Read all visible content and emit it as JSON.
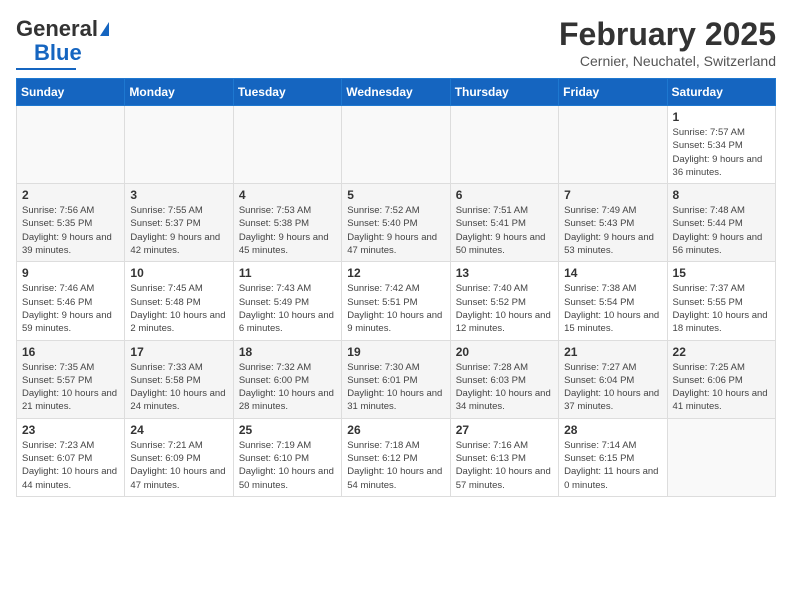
{
  "header": {
    "logo_general": "General",
    "logo_blue": "Blue",
    "main_title": "February 2025",
    "subtitle": "Cernier, Neuchatel, Switzerland"
  },
  "weekdays": [
    "Sunday",
    "Monday",
    "Tuesday",
    "Wednesday",
    "Thursday",
    "Friday",
    "Saturday"
  ],
  "weeks": [
    [
      {
        "day": "",
        "info": ""
      },
      {
        "day": "",
        "info": ""
      },
      {
        "day": "",
        "info": ""
      },
      {
        "day": "",
        "info": ""
      },
      {
        "day": "",
        "info": ""
      },
      {
        "day": "",
        "info": ""
      },
      {
        "day": "1",
        "info": "Sunrise: 7:57 AM\nSunset: 5:34 PM\nDaylight: 9 hours and 36 minutes."
      }
    ],
    [
      {
        "day": "2",
        "info": "Sunrise: 7:56 AM\nSunset: 5:35 PM\nDaylight: 9 hours and 39 minutes."
      },
      {
        "day": "3",
        "info": "Sunrise: 7:55 AM\nSunset: 5:37 PM\nDaylight: 9 hours and 42 minutes."
      },
      {
        "day": "4",
        "info": "Sunrise: 7:53 AM\nSunset: 5:38 PM\nDaylight: 9 hours and 45 minutes."
      },
      {
        "day": "5",
        "info": "Sunrise: 7:52 AM\nSunset: 5:40 PM\nDaylight: 9 hours and 47 minutes."
      },
      {
        "day": "6",
        "info": "Sunrise: 7:51 AM\nSunset: 5:41 PM\nDaylight: 9 hours and 50 minutes."
      },
      {
        "day": "7",
        "info": "Sunrise: 7:49 AM\nSunset: 5:43 PM\nDaylight: 9 hours and 53 minutes."
      },
      {
        "day": "8",
        "info": "Sunrise: 7:48 AM\nSunset: 5:44 PM\nDaylight: 9 hours and 56 minutes."
      }
    ],
    [
      {
        "day": "9",
        "info": "Sunrise: 7:46 AM\nSunset: 5:46 PM\nDaylight: 9 hours and 59 minutes."
      },
      {
        "day": "10",
        "info": "Sunrise: 7:45 AM\nSunset: 5:48 PM\nDaylight: 10 hours and 2 minutes."
      },
      {
        "day": "11",
        "info": "Sunrise: 7:43 AM\nSunset: 5:49 PM\nDaylight: 10 hours and 6 minutes."
      },
      {
        "day": "12",
        "info": "Sunrise: 7:42 AM\nSunset: 5:51 PM\nDaylight: 10 hours and 9 minutes."
      },
      {
        "day": "13",
        "info": "Sunrise: 7:40 AM\nSunset: 5:52 PM\nDaylight: 10 hours and 12 minutes."
      },
      {
        "day": "14",
        "info": "Sunrise: 7:38 AM\nSunset: 5:54 PM\nDaylight: 10 hours and 15 minutes."
      },
      {
        "day": "15",
        "info": "Sunrise: 7:37 AM\nSunset: 5:55 PM\nDaylight: 10 hours and 18 minutes."
      }
    ],
    [
      {
        "day": "16",
        "info": "Sunrise: 7:35 AM\nSunset: 5:57 PM\nDaylight: 10 hours and 21 minutes."
      },
      {
        "day": "17",
        "info": "Sunrise: 7:33 AM\nSunset: 5:58 PM\nDaylight: 10 hours and 24 minutes."
      },
      {
        "day": "18",
        "info": "Sunrise: 7:32 AM\nSunset: 6:00 PM\nDaylight: 10 hours and 28 minutes."
      },
      {
        "day": "19",
        "info": "Sunrise: 7:30 AM\nSunset: 6:01 PM\nDaylight: 10 hours and 31 minutes."
      },
      {
        "day": "20",
        "info": "Sunrise: 7:28 AM\nSunset: 6:03 PM\nDaylight: 10 hours and 34 minutes."
      },
      {
        "day": "21",
        "info": "Sunrise: 7:27 AM\nSunset: 6:04 PM\nDaylight: 10 hours and 37 minutes."
      },
      {
        "day": "22",
        "info": "Sunrise: 7:25 AM\nSunset: 6:06 PM\nDaylight: 10 hours and 41 minutes."
      }
    ],
    [
      {
        "day": "23",
        "info": "Sunrise: 7:23 AM\nSunset: 6:07 PM\nDaylight: 10 hours and 44 minutes."
      },
      {
        "day": "24",
        "info": "Sunrise: 7:21 AM\nSunset: 6:09 PM\nDaylight: 10 hours and 47 minutes."
      },
      {
        "day": "25",
        "info": "Sunrise: 7:19 AM\nSunset: 6:10 PM\nDaylight: 10 hours and 50 minutes."
      },
      {
        "day": "26",
        "info": "Sunrise: 7:18 AM\nSunset: 6:12 PM\nDaylight: 10 hours and 54 minutes."
      },
      {
        "day": "27",
        "info": "Sunrise: 7:16 AM\nSunset: 6:13 PM\nDaylight: 10 hours and 57 minutes."
      },
      {
        "day": "28",
        "info": "Sunrise: 7:14 AM\nSunset: 6:15 PM\nDaylight: 11 hours and 0 minutes."
      },
      {
        "day": "",
        "info": ""
      }
    ]
  ]
}
